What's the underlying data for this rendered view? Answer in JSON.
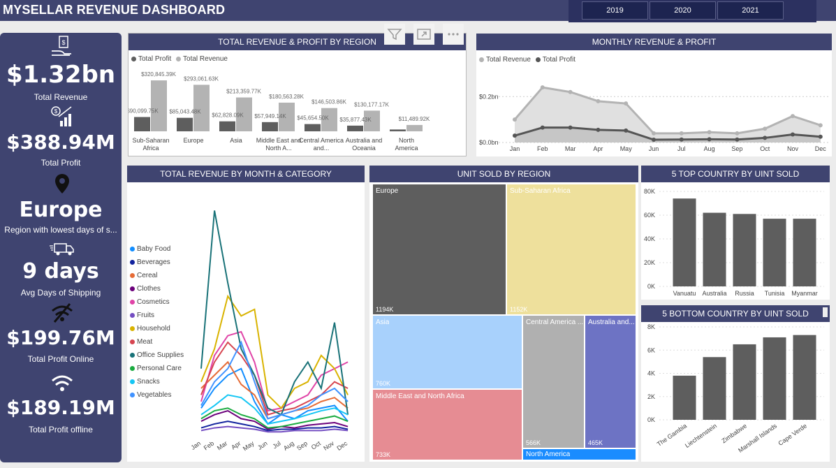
{
  "header": {
    "title": "MYSELLAR REVENUE DASHBOARD",
    "years": [
      "2019",
      "2020",
      "2021"
    ]
  },
  "kpis": [
    {
      "icon": "money-hand-icon",
      "value": "$1.32bn",
      "label": "Total Revenue"
    },
    {
      "icon": "growth-chart-icon",
      "value": "$388.94M",
      "label": "Total Profit"
    },
    {
      "icon": "location-pin-icon",
      "value": "Europe",
      "label": "Region with lowest days of s..."
    },
    {
      "icon": "delivery-truck-icon",
      "value": "9 days",
      "label": "Avg Days of Shipping"
    },
    {
      "icon": "wifi-off-icon",
      "value": "$199.76M",
      "label": "Total Profit Online"
    },
    {
      "icon": "wifi-icon",
      "value": "$189.19M",
      "label": "Total Profit offline"
    }
  ],
  "visual_tools": {
    "filter": "filter-icon",
    "focus": "focus-mode-icon",
    "more": "more-options-icon"
  },
  "region_card": {
    "title": "TOTAL REVENUE & PROFIT BY REGION",
    "legend": [
      "Total Profit",
      "Total Revenue"
    ],
    "colors": {
      "profit": "#5e5e5e",
      "revenue": "#b3b3b3"
    }
  },
  "monthly_card": {
    "title": "MONTHLY REVENUE & PROFIT",
    "legend": [
      "Total Revenue",
      "Total Profit"
    ],
    "colors": {
      "revenue": "#b3b3b3",
      "profit": "#555555"
    }
  },
  "category_card": {
    "title": "TOTAL REVENUE BY MONTH & CATEGORY",
    "colors": [
      "#118dff",
      "#12239e",
      "#e66c37",
      "#6b007b",
      "#e044a7",
      "#744ec2",
      "#d9b300",
      "#d64550",
      "#197278",
      "#1aab40",
      "#15c6f4",
      "#4092ff"
    ]
  },
  "units_card": {
    "title": "UNIT SOLD BY REGION",
    "tiles": [
      {
        "name": "Europe",
        "value": "1194K",
        "color": "#5e5e5e"
      },
      {
        "name": "Sub-Saharan Africa",
        "value": "1152K",
        "color": "#eee09c"
      },
      {
        "name": "Asia",
        "value": "760K",
        "color": "#a8d1fc"
      },
      {
        "name": "Middle East and North Africa",
        "value": "733K",
        "color": "#e68c93"
      },
      {
        "name": "Central America ...",
        "value": "566K",
        "color": "#b0b0b0"
      },
      {
        "name": "Australia and...",
        "value": "465K",
        "color": "#6d73c4"
      },
      {
        "name": "North America",
        "value": "",
        "color": "#1a8cff"
      }
    ]
  },
  "top_card": {
    "title": "5 TOP COUNTRY BY UINT SOLD"
  },
  "bottom_card": {
    "title": "5 BOTTOM COUNTRY BY UINT SOLD"
  },
  "chart_data": [
    {
      "type": "bar",
      "title": "TOTAL REVENUE & PROFIT BY REGION",
      "categories": [
        "Sub-Saharan Africa",
        "Europe",
        "Asia",
        "Middle East and North A...",
        "Central America and...",
        "Australia and Oceania",
        "North America"
      ],
      "series": [
        {
          "name": "Total Profit",
          "values": [
            90099.75,
            85043.48,
            62828.09,
            57949.14,
            45654.5,
            35877.43,
            11489.92
          ],
          "labels": [
            "$90,099.75K",
            "$85,043.48K",
            "$62,828.09K",
            "$57,949.14K",
            "$45,654.50K",
            "$35,877.43K",
            ""
          ]
        },
        {
          "name": "Total Revenue",
          "values": [
            320845.39,
            293061.63,
            213359.77,
            180563.28,
            146503.86,
            130177.17,
            40000
          ],
          "labels": [
            "$320,845.39K",
            "$293,061.63K",
            "$213,359.77K",
            "$180,563.28K",
            "$146,503.86K",
            "$130,177.17K",
            "$11,489.92K"
          ]
        }
      ],
      "legend": "top-left"
    },
    {
      "type": "area",
      "title": "MONTHLY REVENUE & PROFIT",
      "x": [
        "Jan",
        "Feb",
        "Mar",
        "Apr",
        "May",
        "Jun",
        "Jul",
        "Aug",
        "Sep",
        "Oct",
        "Nov",
        "Dec"
      ],
      "series": [
        {
          "name": "Total Revenue",
          "values": [
            0.1,
            0.24,
            0.22,
            0.18,
            0.17,
            0.04,
            0.04,
            0.045,
            0.04,
            0.06,
            0.115,
            0.075
          ]
        },
        {
          "name": "Total Profit",
          "values": [
            0.03,
            0.065,
            0.065,
            0.055,
            0.052,
            0.012,
            0.013,
            0.014,
            0.013,
            0.02,
            0.035,
            0.025
          ]
        }
      ],
      "ytick_labels": [
        "$0.0bn",
        "$0.2bn"
      ],
      "ylim": [
        0,
        0.28
      ],
      "grid": true,
      "legend": "top-left"
    },
    {
      "type": "line",
      "title": "TOTAL REVENUE BY MONTH & CATEGORY",
      "x": [
        "Jan",
        "Feb",
        "Mar",
        "Apr",
        "May",
        "Jun",
        "Jul",
        "Aug",
        "Sep",
        "Oct",
        "Nov",
        "Dec"
      ],
      "series": [
        {
          "name": "Baby Food",
          "values": [
            20,
            35,
            45,
            50,
            25,
            8,
            15,
            12,
            18,
            20,
            22,
            10
          ]
        },
        {
          "name": "Beverages",
          "values": [
            5,
            8,
            10,
            8,
            6,
            3,
            4,
            4,
            5,
            5,
            6,
            4
          ]
        },
        {
          "name": "Cereal",
          "values": [
            35,
            45,
            55,
            38,
            30,
            12,
            15,
            18,
            20,
            25,
            28,
            20
          ]
        },
        {
          "name": "Clothes",
          "values": [
            10,
            15,
            18,
            12,
            10,
            4,
            6,
            5,
            7,
            8,
            9,
            6
          ]
        },
        {
          "name": "Cosmetics",
          "values": [
            25,
            60,
            75,
            78,
            55,
            18,
            20,
            25,
            30,
            45,
            50,
            55
          ]
        },
        {
          "name": "Fruits",
          "values": [
            3,
            5,
            6,
            5,
            4,
            2,
            2,
            3,
            3,
            3,
            4,
            3
          ]
        },
        {
          "name": "Household",
          "values": [
            40,
            65,
            105,
            90,
            95,
            30,
            20,
            35,
            40,
            60,
            50,
            30
          ]
        },
        {
          "name": "Meat",
          "values": [
            30,
            55,
            70,
            60,
            45,
            15,
            18,
            20,
            25,
            30,
            40,
            35
          ]
        },
        {
          "name": "Office Supplies",
          "values": [
            50,
            170,
            115,
            65,
            45,
            20,
            15,
            40,
            55,
            35,
            85,
            15
          ]
        },
        {
          "name": "Personal Care",
          "values": [
            12,
            18,
            20,
            15,
            12,
            5,
            6,
            8,
            10,
            12,
            14,
            10
          ]
        },
        {
          "name": "Snacks",
          "values": [
            15,
            22,
            30,
            28,
            20,
            8,
            10,
            12,
            15,
            18,
            20,
            15
          ]
        },
        {
          "name": "Vegetables",
          "values": [
            22,
            40,
            50,
            70,
            40,
            12,
            15,
            18,
            22,
            30,
            35,
            25
          ]
        }
      ],
      "legend": "left"
    },
    {
      "type": "heatmap",
      "title": "UNIT SOLD BY REGION",
      "categories": [
        "Europe",
        "Sub-Saharan Africa",
        "Asia",
        "Middle East and North Africa",
        "Central America ...",
        "Australia and...",
        "North America"
      ],
      "values": [
        1194,
        1152,
        760,
        733,
        566,
        465,
        120
      ]
    },
    {
      "type": "bar",
      "title": "5 TOP COUNTRY BY UINT SOLD",
      "categories": [
        "Vanuatu",
        "Australia",
        "Russia",
        "Tunisia",
        "Myanmar"
      ],
      "values": [
        74000,
        62000,
        61000,
        57000,
        57000
      ],
      "ytick_labels": [
        "0K",
        "20K",
        "40K",
        "60K",
        "80K"
      ],
      "ylim": [
        0,
        80000
      ]
    },
    {
      "type": "bar",
      "title": "5 BOTTOM COUNTRY BY UINT SOLD",
      "categories": [
        "The Gambia",
        "Liechtenstein",
        "Zimbabwe",
        "Marshall Islands",
        "Cape Verde"
      ],
      "values": [
        3800,
        5400,
        6500,
        7100,
        7300
      ],
      "ytick_labels": [
        "0K",
        "2K",
        "4K",
        "6K",
        "8K"
      ],
      "ylim": [
        0,
        8000
      ]
    }
  ]
}
